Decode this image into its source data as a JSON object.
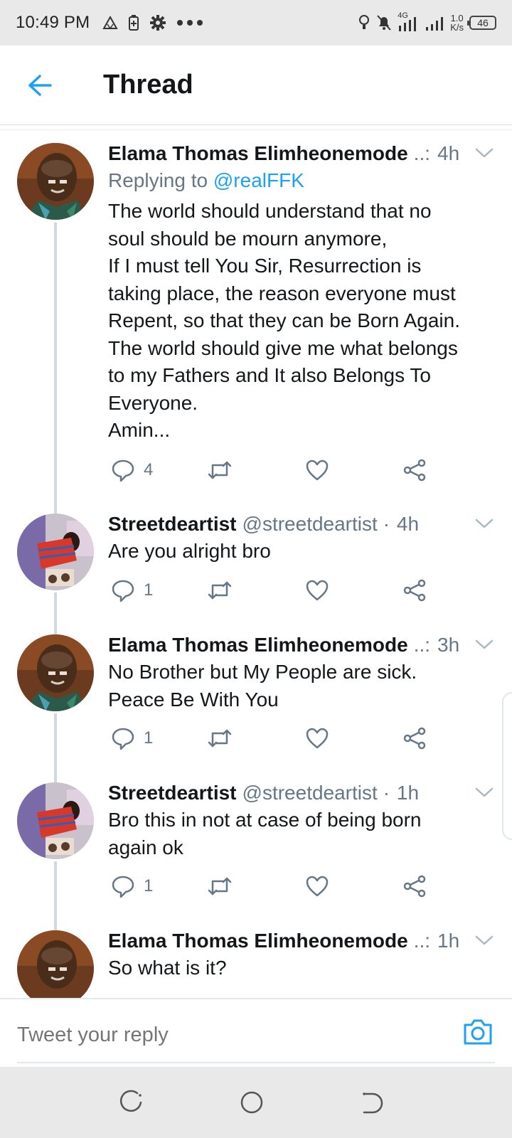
{
  "status_bar": {
    "time": "10:49 PM",
    "network": "4G",
    "speed_top": "1.0",
    "speed_bottom": "K/s",
    "battery": "46",
    "icons": [
      "triangle-icon",
      "battery-saver-icon",
      "settings-icon",
      "more-dots-icon",
      "location-icon",
      "mute-icon",
      "signal-icon",
      "signal-2-icon"
    ]
  },
  "header": {
    "title": "Thread",
    "back_icon": "arrow-left-icon"
  },
  "tweets": [
    {
      "name": "Elama Thomas Elimheonemode",
      "handle": "..:",
      "time": "4h",
      "replying_label": "Replying to",
      "replying_to": "@realFFK",
      "text": "The world should understand that no\nsoul should be mourn anymore,\nIf I must tell You Sir, Resurrection is\ntaking place, the reason everyone must\nRepent, so that they can be Born Again.\nThe world should give me what belongs\nto my Fathers and It also Belongs To\nEveryone.\nAmin...",
      "reply_count": "4"
    },
    {
      "name": "Streetdeartist",
      "handle": "@streetdeartist ·",
      "time": "4h",
      "text": "Are you alright bro",
      "reply_count": "1"
    },
    {
      "name": "Elama Thomas Elimheonemode",
      "handle": "..:",
      "time": "3h",
      "text": "No Brother but My People are sick.\nPeace Be With You",
      "reply_count": "1"
    },
    {
      "name": "Streetdeartist",
      "handle": "@streetdeartist ·",
      "time": "1h",
      "text": "Bro this in not at case of being born\nagain ok",
      "reply_count": "1"
    },
    {
      "name": "Elama Thomas Elimheonemode",
      "handle": "..:",
      "time": "1h",
      "text": "So what is it?"
    }
  ],
  "reply_bar": {
    "placeholder": "Tweet your reply",
    "camera_icon": "camera-icon"
  },
  "nav_bar": {
    "icons": [
      "recents-icon",
      "home-icon",
      "back-icon"
    ]
  },
  "colors": {
    "accent": "#1da1f2",
    "secondary_text": "#657786",
    "primary_text": "#14171a",
    "thread_line": "#cfd9de",
    "system_bar": "#e9e9e9"
  }
}
